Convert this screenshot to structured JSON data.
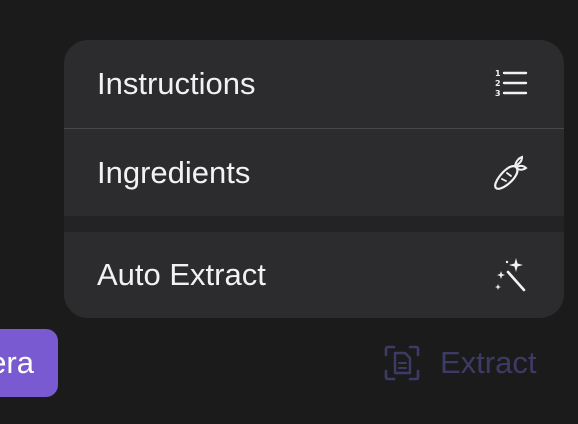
{
  "menu": {
    "items": [
      {
        "label": "Instructions",
        "icon": "numbered-list-icon"
      },
      {
        "label": "Ingredients",
        "icon": "carrot-icon"
      },
      {
        "label": "Auto Extract",
        "icon": "magic-wand-icon"
      }
    ]
  },
  "toolbar": {
    "camera_label": "era",
    "extract_label": "Extract",
    "extract_icon": "document-scan-icon"
  },
  "colors": {
    "background": "#1b1b1c",
    "menu_background": "#2c2c2e",
    "text": "#f2f2f4",
    "accent_purple": "#7a5ad0",
    "disabled_extract": "#3d3a66"
  }
}
